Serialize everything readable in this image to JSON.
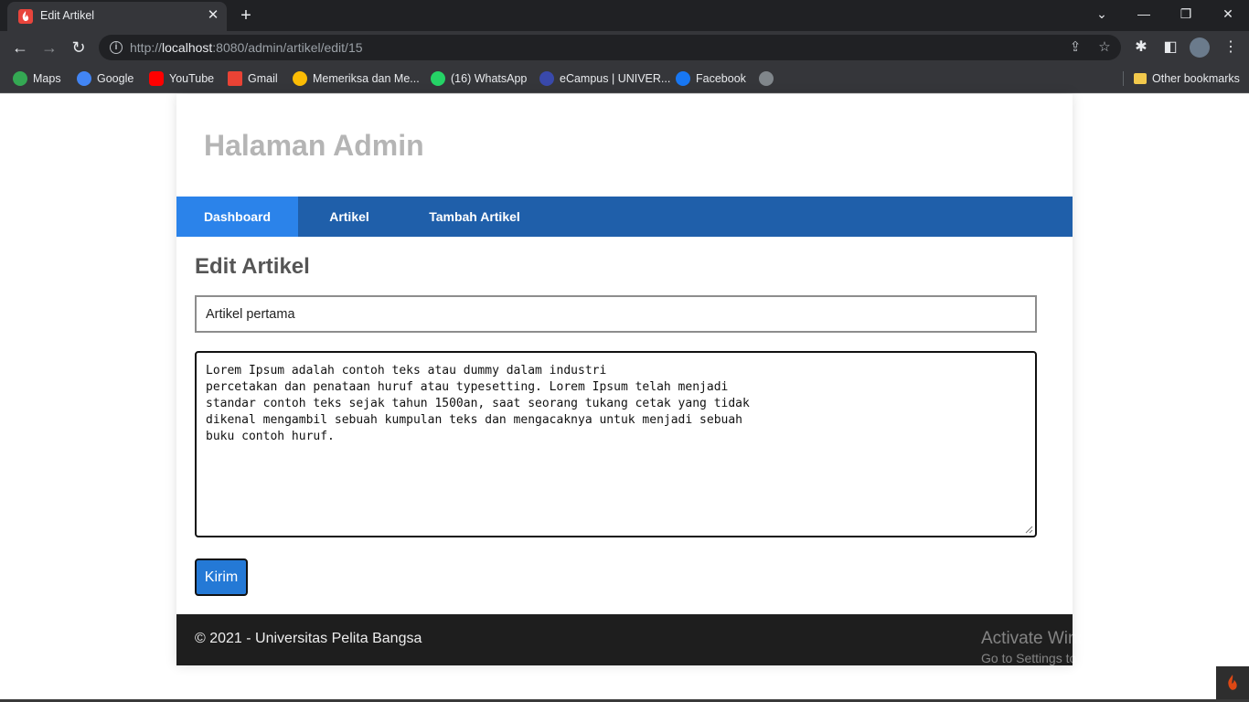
{
  "browser": {
    "tab_title": "Edit Artikel",
    "url_prefix": "http://",
    "url_host": "localhost",
    "url_rest": ":8080/admin/artikel/edit/15",
    "bookmarks": [
      {
        "label": "Maps",
        "color": "#34a853"
      },
      {
        "label": "Google",
        "color": "#4285f4"
      },
      {
        "label": "YouTube",
        "color": "#ff0000"
      },
      {
        "label": "Gmail",
        "color": "#ea4335"
      },
      {
        "label": "Memeriksa dan Me...",
        "color": "#fbbc05"
      },
      {
        "label": "(16) WhatsApp",
        "color": "#25d366"
      },
      {
        "label": "eCampus | UNIVER...",
        "color": "#3949ab"
      },
      {
        "label": "Facebook",
        "color": "#1877f2"
      }
    ],
    "other_bookmarks": "Other bookmarks"
  },
  "site": {
    "title": "Halaman Admin",
    "nav": [
      {
        "label": "Dashboard",
        "active": true
      },
      {
        "label": "Artikel",
        "active": false
      },
      {
        "label": "Tambah Artikel",
        "active": false
      }
    ]
  },
  "form": {
    "heading": "Edit Artikel",
    "title_value": "Artikel pertama",
    "body_value": "Lorem Ipsum adalah contoh teks atau dummy dalam industri\npercetakan dan penataan huruf atau typesetting. Lorem Ipsum telah menjadi\nstandar contoh teks sejak tahun 1500an, saat seorang tukang cetak yang tidak\ndikenal mengambil sebuah kumpulan teks dan mengacaknya untuk menjadi sebuah\nbuku contoh huruf.",
    "submit_label": "Kirim"
  },
  "footer": {
    "text": "© 2021 - Universitas Pelita Bangsa"
  },
  "watermark": {
    "title": "Activate Windows",
    "subtitle": "Go to Settings to activate Windows."
  },
  "colors": {
    "nav_bg": "#1f5faa",
    "nav_active": "#2b83ea",
    "button": "#2479d6",
    "footer_bg": "#1e1e1e"
  }
}
